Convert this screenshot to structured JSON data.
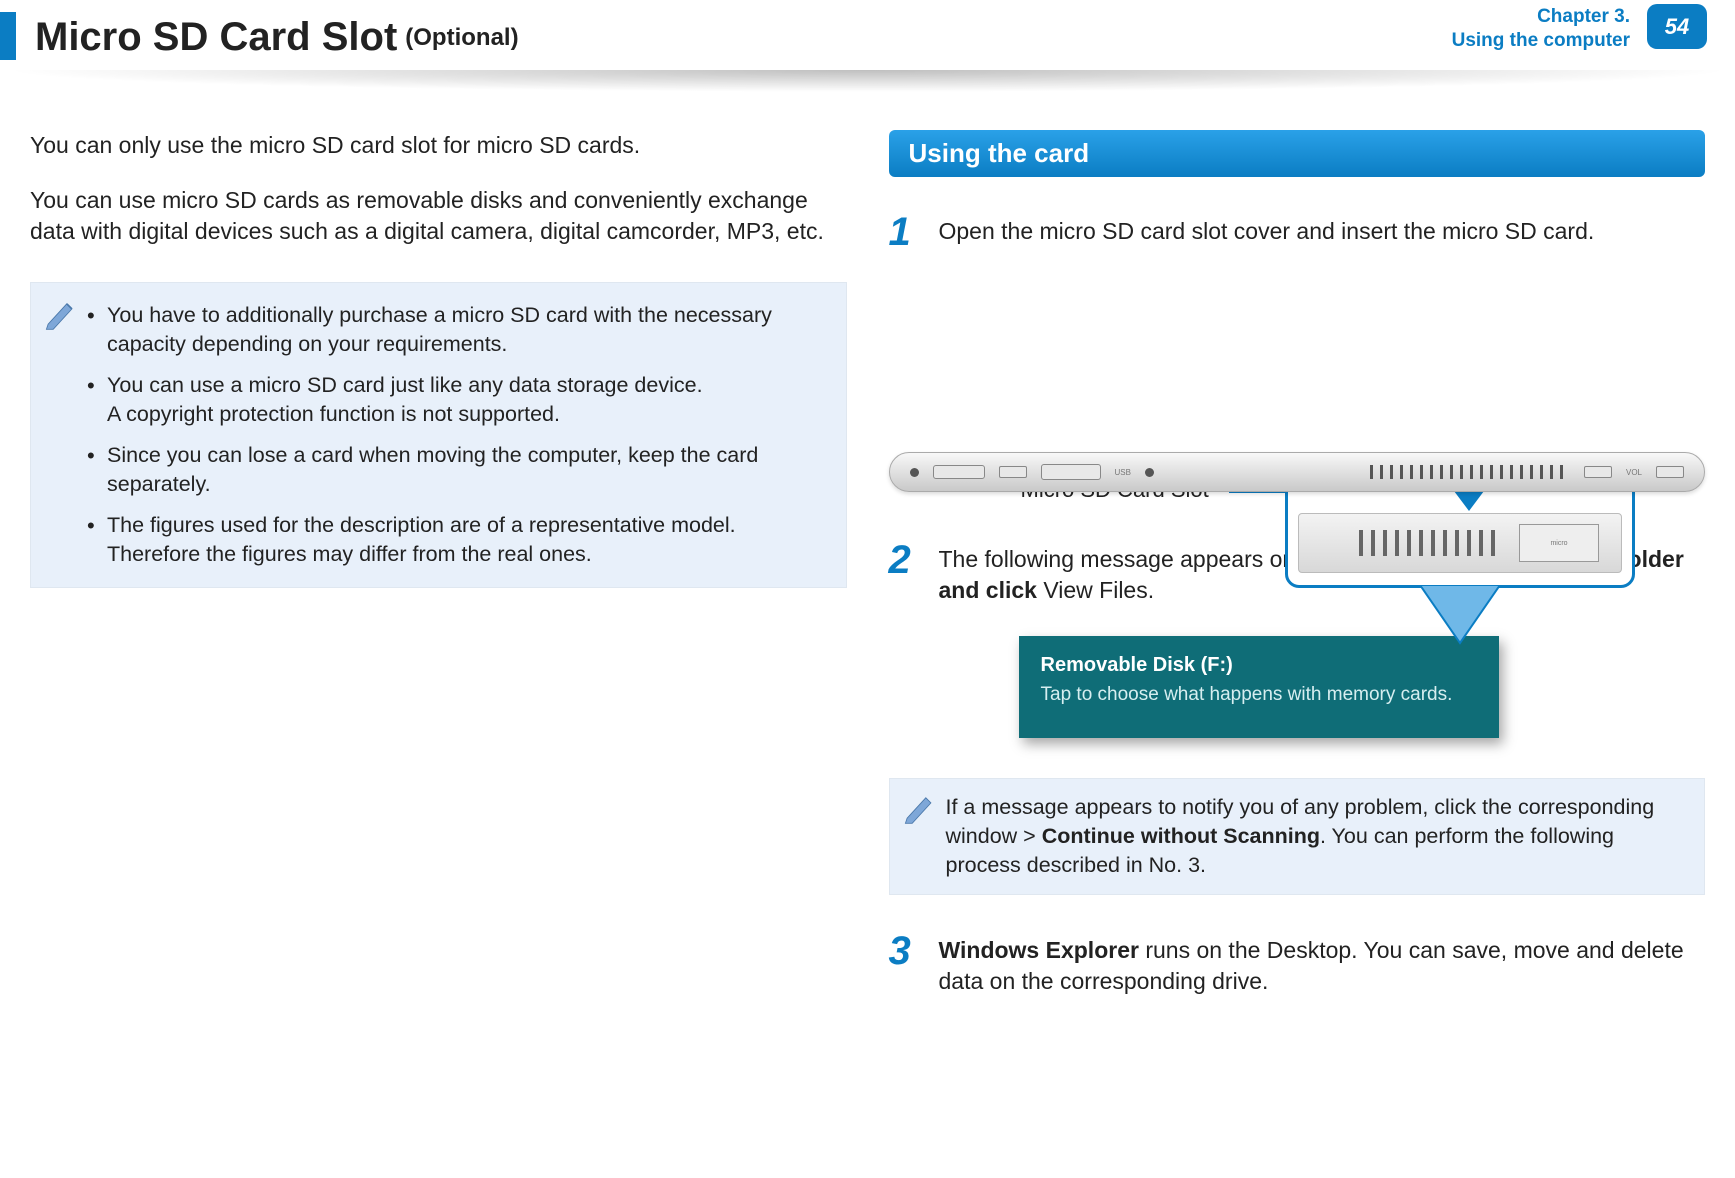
{
  "header": {
    "title_main": "Micro SD Card Slot",
    "title_sub": "(Optional)",
    "chapter_line1": "Chapter 3.",
    "chapter_line2": "Using the computer",
    "page_number": "54"
  },
  "left": {
    "intro1": "You can only use the micro SD card slot for micro SD cards.",
    "intro2": "You can use micro SD cards as removable disks and conveniently exchange data with digital devices such as a digital camera, digital camcorder, MP3, etc.",
    "notes": [
      "You have to additionally purchase a micro SD card with the necessary capacity depending on your requirements.",
      "You can use a micro SD card just like any data storage device.\nA copyright protection function is not supported.",
      "Since you can lose a card when moving the computer, keep the card separately.",
      "The figures used for the description are of a representative model. Therefore the figures may differ from the real ones."
    ]
  },
  "right": {
    "section_title": "Using the card",
    "step1_text": "Open the micro SD card slot cover and insert the micro SD card.",
    "figure_label": "Micro SD Card Slot",
    "sd_label": "micro",
    "side_label_usb": "USB",
    "side_label_vol": "VOL",
    "step2_prefix": "The following message appears on the top right. Click to ",
    "step2_bold": "open the folder and click",
    "step2_suffix": " View Files.",
    "toast_title": "Removable Disk (F:)",
    "toast_sub": "Tap to choose what happens with memory cards.",
    "note2_prefix": "If a message appears to notify you of any problem, click the corresponding window > ",
    "note2_bold": "Continue without Scanning",
    "note2_suffix": ". You can perform the following process described in No. 3.",
    "step3_bold": "Windows Explorer",
    "step3_suffix": " runs on the Desktop. You can save, move and delete data on the corresponding drive."
  },
  "nums": {
    "one": "1",
    "two": "2",
    "three": "3"
  }
}
